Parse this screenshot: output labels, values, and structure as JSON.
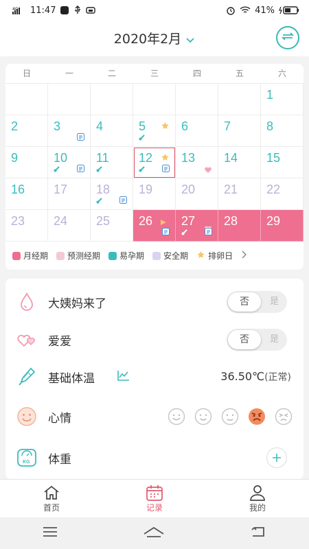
{
  "status_bar": {
    "time": "11:47",
    "network": "4G",
    "battery": "41%"
  },
  "header": {
    "month": "2020年2月"
  },
  "calendar": {
    "weekdays": [
      "日",
      "一",
      "二",
      "三",
      "四",
      "五",
      "六"
    ],
    "days": [
      "1",
      "2",
      "3",
      "4",
      "5",
      "6",
      "7",
      "8",
      "9",
      "10",
      "11",
      "12",
      "13",
      "14",
      "15",
      "16",
      "17",
      "18",
      "19",
      "20",
      "21",
      "22",
      "23",
      "24",
      "25",
      "26",
      "27",
      "28",
      "29"
    ]
  },
  "legend": {
    "period": "月经期",
    "predicted": "预测经期",
    "fertile": "易孕期",
    "safe": "安全期",
    "ovulation": "排卵日"
  },
  "records": {
    "period_label": "大姨妈来了",
    "love_label": "爱爱",
    "toggle_no": "否",
    "toggle_yes": "是",
    "temp_label": "基础体温",
    "temp_value": "36.50℃",
    "temp_status": "(正常)",
    "mood_label": "心情",
    "weight_label": "体重"
  },
  "tabs": {
    "home": "首页",
    "record": "记录",
    "mine": "我的"
  },
  "colors": {
    "accent": "#3bbcbc",
    "period": "#ee6f8f",
    "active_tab": "#e25a6e"
  }
}
